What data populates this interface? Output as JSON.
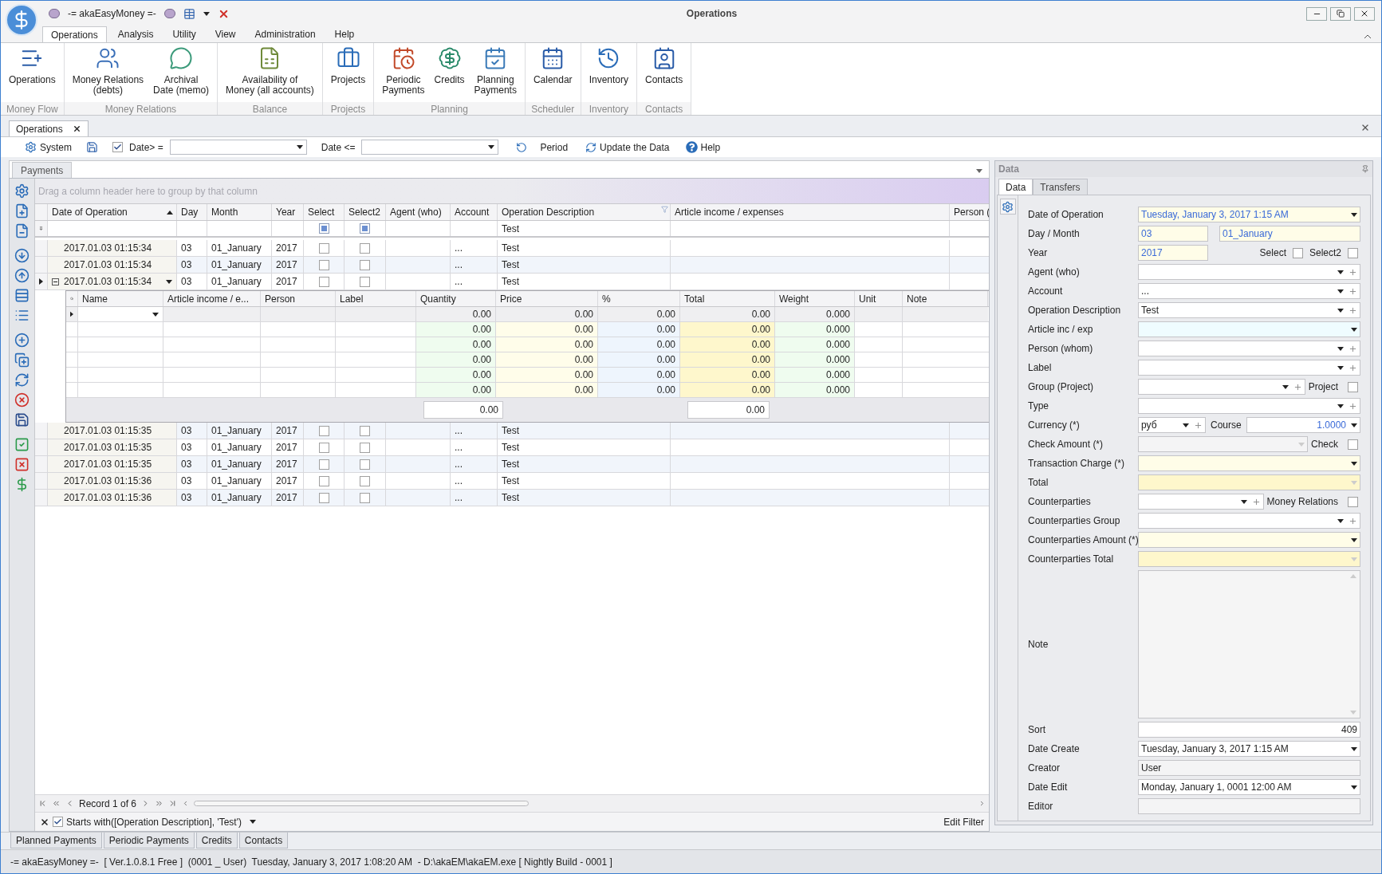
{
  "window": {
    "app_title": "-= akaEasyMoney =-",
    "title": "Operations"
  },
  "ribbon": {
    "tabs": [
      {
        "label": "Operations",
        "selected": true
      },
      {
        "label": "Analysis",
        "selected": false
      },
      {
        "label": "Utility",
        "selected": false
      },
      {
        "label": "View",
        "selected": false
      },
      {
        "label": "Administration",
        "selected": false
      },
      {
        "label": "Help",
        "selected": false
      }
    ],
    "groups": [
      {
        "label": "Money Flow",
        "buttons": [
          "Operations"
        ]
      },
      {
        "label": "Money Relations",
        "buttons": [
          "Money Relations\n(debts)",
          "Archival\nDate (memo)"
        ]
      },
      {
        "label": "Balance",
        "buttons": [
          "Availability of\nMoney (all accounts)"
        ]
      },
      {
        "label": "Projects",
        "buttons": [
          "Projects"
        ]
      },
      {
        "label": "Planning",
        "buttons": [
          "Periodic\nPayments",
          "Credits",
          "Planning\nPayments"
        ]
      },
      {
        "label": "Scheduler",
        "buttons": [
          "Calendar"
        ]
      },
      {
        "label": "Inventory",
        "buttons": [
          "Inventory"
        ]
      },
      {
        "label": "Contacts",
        "buttons": [
          "Contacts"
        ]
      }
    ]
  },
  "document_tabs": [
    {
      "label": "Operations",
      "selected": true
    }
  ],
  "toolbar": {
    "system": "System",
    "date_from_checked": true,
    "date_from_label": "Date> =",
    "date_to_label": "Date <=",
    "period": "Period",
    "update": "Update the Data",
    "help": "Help"
  },
  "payments": {
    "tab": "Payments",
    "group_hint": "Drag a column header here to group by that column",
    "columns": [
      {
        "label": "Date of Operation",
        "sorted": true,
        "filtered": false
      },
      {
        "label": "Day",
        "sorted": false,
        "filtered": false
      },
      {
        "label": "Month",
        "sorted": false,
        "filtered": false
      },
      {
        "label": "Year",
        "sorted": false,
        "filtered": false
      },
      {
        "label": "Select",
        "sorted": false,
        "filtered": false
      },
      {
        "label": "Select2",
        "sorted": false,
        "filtered": false
      },
      {
        "label": "Agent (who)",
        "sorted": false,
        "filtered": false
      },
      {
        "label": "Account",
        "sorted": false,
        "filtered": false
      },
      {
        "label": "Operation Description",
        "sorted": false,
        "filtered": true
      },
      {
        "label": "Article income / expenses",
        "sorted": false,
        "filtered": false
      },
      {
        "label": "Person (",
        "sorted": false,
        "filtered": false
      }
    ],
    "filter_row": {
      "select_indeterminate": true,
      "select2_indeterminate": true,
      "description": "Test"
    },
    "rows": [
      {
        "date": "2017.01.03 01:15:34",
        "day": "03",
        "month": "01_January",
        "year": "2017",
        "select": false,
        "select2": false,
        "account": "...",
        "description": "Test",
        "focused": false,
        "expanded": false
      },
      {
        "date": "2017.01.03 01:15:34",
        "day": "03",
        "month": "01_January",
        "year": "2017",
        "select": false,
        "select2": false,
        "account": "...",
        "description": "Test",
        "focused": false,
        "expanded": false
      },
      {
        "date": "2017.01.03 01:15:34",
        "day": "03",
        "month": "01_January",
        "year": "2017",
        "select": false,
        "select2": false,
        "account": "...",
        "description": "Test",
        "focused": true,
        "expanded": true,
        "detail": {
          "columns": [
            "Name",
            "Article income / e...",
            "Person",
            "Label",
            "Quantity",
            "Price",
            "%",
            "Total",
            "Weight",
            "Unit",
            "Note"
          ],
          "rows": [
            {
              "kind": "new",
              "quantity": "0.00",
              "price": "0.00",
              "percent": "0.00",
              "total": "0.00",
              "weight": "0.000"
            },
            {
              "kind": "item",
              "quantity": "0.00",
              "price": "0.00",
              "percent": "0.00",
              "total": "0.00",
              "weight": "0.000"
            },
            {
              "kind": "item",
              "quantity": "0.00",
              "price": "0.00",
              "percent": "0.00",
              "total": "0.00",
              "weight": "0.000"
            },
            {
              "kind": "item",
              "quantity": "0.00",
              "price": "0.00",
              "percent": "0.00",
              "total": "0.00",
              "weight": "0.000"
            },
            {
              "kind": "item",
              "quantity": "0.00",
              "price": "0.00",
              "percent": "0.00",
              "total": "0.00",
              "weight": "0.000"
            },
            {
              "kind": "item",
              "quantity": "0.00",
              "price": "0.00",
              "percent": "0.00",
              "total": "0.00",
              "weight": "0.000"
            }
          ],
          "footer": {
            "quantity": "0.00",
            "total": "0.00"
          }
        }
      },
      {
        "date": "2017.01.03 01:15:35",
        "day": "03",
        "month": "01_January",
        "year": "2017",
        "select": false,
        "select2": false,
        "account": "...",
        "description": "Test",
        "focused": false,
        "expanded": false
      },
      {
        "date": "2017.01.03 01:15:35",
        "day": "03",
        "month": "01_January",
        "year": "2017",
        "select": false,
        "select2": false,
        "account": "...",
        "description": "Test",
        "focused": false,
        "expanded": false
      },
      {
        "date": "2017.01.03 01:15:35",
        "day": "03",
        "month": "01_January",
        "year": "2017",
        "select": false,
        "select2": false,
        "account": "...",
        "description": "Test",
        "focused": false,
        "expanded": false
      },
      {
        "date": "2017.01.03 01:15:36",
        "day": "03",
        "month": "01_January",
        "year": "2017",
        "select": false,
        "select2": false,
        "account": "...",
        "description": "Test",
        "focused": false,
        "expanded": false
      },
      {
        "date": "2017.01.03 01:15:36",
        "day": "03",
        "month": "01_January",
        "year": "2017",
        "select": false,
        "select2": false,
        "account": "...",
        "description": "Test",
        "focused": false,
        "expanded": false
      }
    ],
    "navigator": "Record 1 of 6",
    "filter": {
      "checked": true,
      "text": "Starts with([Operation Description], 'Test')"
    },
    "edit_filter": "Edit Filter"
  },
  "bottom_tabs": [
    "Planned Payments",
    "Periodic Payments",
    "Credits",
    "Contacts"
  ],
  "data_panel": {
    "title": "Data",
    "tabs": [
      {
        "label": "Data",
        "selected": true
      },
      {
        "label": "Transfers",
        "selected": false
      }
    ],
    "fields": [
      {
        "kind": "date",
        "label": "Date of Operation",
        "value": "Tuesday, January 3, 2017 1:15 AM"
      },
      {
        "kind": "pair",
        "label": "Day / Month",
        "values": [
          "03",
          "01_January"
        ]
      },
      {
        "kind": "year_checks",
        "label": "Year",
        "value": "2017",
        "checks": [
          {
            "label": "Select",
            "checked": false
          },
          {
            "label": "Select2",
            "checked": false
          }
        ]
      },
      {
        "kind": "combo_add",
        "label": "Agent (who)"
      },
      {
        "kind": "combo_add",
        "label": "Account",
        "value": "..."
      },
      {
        "kind": "combo_add",
        "label": "Operation Description",
        "value": "Test"
      },
      {
        "kind": "combo_tinted",
        "label": "Article inc / exp"
      },
      {
        "kind": "combo_add",
        "label": "Person (whom)"
      },
      {
        "kind": "combo_add",
        "label": "Label"
      },
      {
        "kind": "combo_add_check",
        "label": "Group (Project)",
        "check": {
          "label": "Project",
          "checked": false
        }
      },
      {
        "kind": "combo_add",
        "label": "Type"
      },
      {
        "kind": "currency",
        "label": "Currency (*)",
        "value": "руб",
        "course_label": "Course",
        "course": "1.0000"
      },
      {
        "kind": "disabled_check",
        "label": "Check Amount (*)",
        "check": {
          "label": "Check",
          "checked": false
        }
      },
      {
        "kind": "combo_yellow",
        "label": "Transaction Charge (*)"
      },
      {
        "kind": "yellow_disabled",
        "label": "Total"
      },
      {
        "kind": "combo_add_check",
        "label": "Counterparties",
        "check": {
          "label": "Money Relations",
          "checked": false
        }
      },
      {
        "kind": "combo_add",
        "label": "Counterparties Group"
      },
      {
        "kind": "combo_yellow",
        "label": "Counterparties Amount (*)"
      },
      {
        "kind": "yellow_disabled",
        "label": "Counterparties Total"
      },
      {
        "kind": "memo",
        "label": "Note"
      },
      {
        "kind": "number",
        "label": "Sort",
        "value": "409"
      },
      {
        "kind": "combo",
        "label": "Date Create",
        "value": "Tuesday, January 3, 2017 1:15 AM"
      },
      {
        "kind": "readonly",
        "label": "Creator",
        "value": "User"
      },
      {
        "kind": "combo",
        "label": "Date Edit",
        "value": "Monday, January 1, 0001 12:00 AM"
      },
      {
        "kind": "readonly",
        "label": "Editor"
      }
    ]
  },
  "status_bar": "-= akaEasyMoney =-  [ Ver.1.0.8.1 Free ]  (0001 _ User)  Tuesday, January 3, 2017 1:08:20 AM  - D:\\akaEM\\akaEM.exe [ Nightly Build - 0001 ]"
}
